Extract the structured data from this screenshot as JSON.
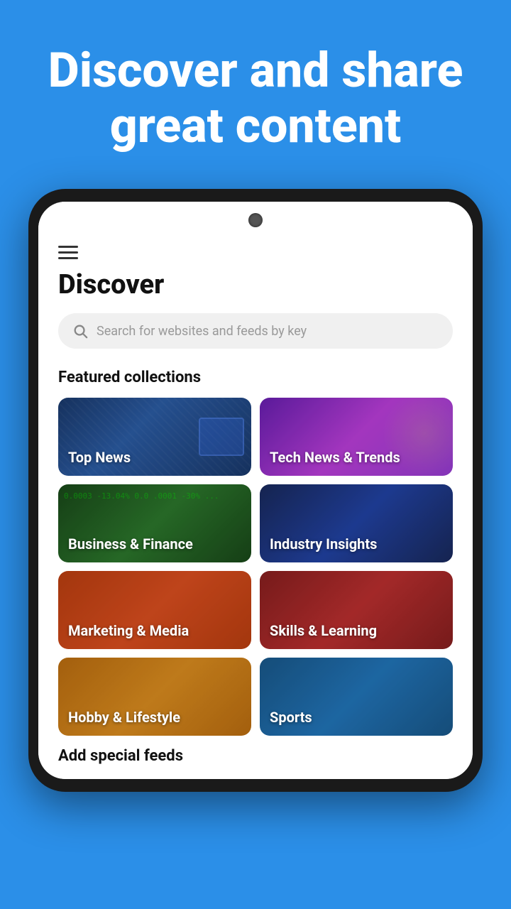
{
  "hero": {
    "title": "Discover and share great content"
  },
  "app": {
    "page_title": "Discover",
    "search_placeholder": "Search for websites and feeds by key",
    "featured_section_label": "Featured collections",
    "add_feeds_label": "Add special feeds",
    "cards": [
      {
        "id": "top-news",
        "label": "Top News",
        "color_class": "card-top-news"
      },
      {
        "id": "tech-news",
        "label": "Tech News & Trends",
        "color_class": "card-tech-news"
      },
      {
        "id": "business",
        "label": "Business & Finance",
        "color_class": "card-business"
      },
      {
        "id": "industry",
        "label": "Industry Insights",
        "color_class": "card-industry"
      },
      {
        "id": "marketing",
        "label": "Marketing & Media",
        "color_class": "card-marketing"
      },
      {
        "id": "skills",
        "label": "Skills & Learning",
        "color_class": "card-skills"
      },
      {
        "id": "hobby",
        "label": "Hobby & Lifestyle",
        "color_class": "card-hobby"
      },
      {
        "id": "sports",
        "label": "Sports",
        "color_class": "card-sports"
      }
    ]
  }
}
